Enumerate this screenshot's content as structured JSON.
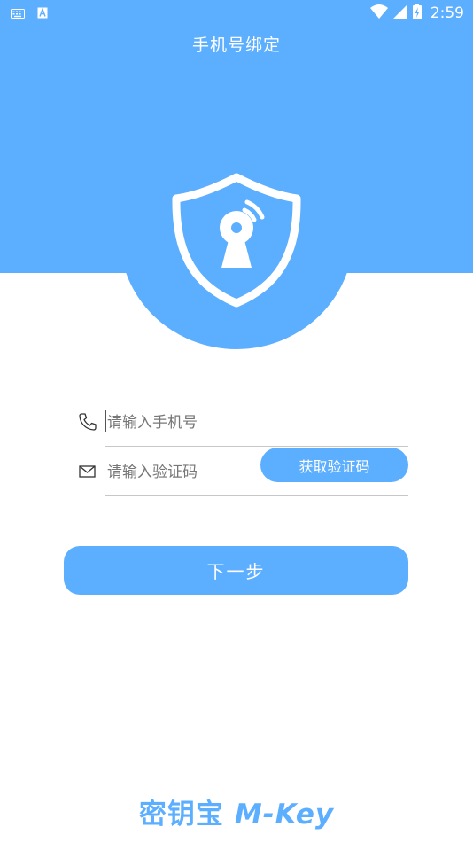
{
  "status_bar": {
    "time": "2:59",
    "icons": [
      "keyboard-icon",
      "a-notification-icon",
      "wifi-icon",
      "cell-signal-icon",
      "battery-charging-icon"
    ]
  },
  "header": {
    "title": "手机号绑定",
    "emblem_icon": "shield-key-icon",
    "background_color": "#5caeff"
  },
  "form": {
    "phone": {
      "icon": "phone-icon",
      "placeholder": "请输入手机号",
      "value": ""
    },
    "code": {
      "icon": "mail-icon",
      "placeholder": "请输入验证码",
      "value": "",
      "get_code_label": "获取验证码"
    },
    "next_label": "下一步"
  },
  "footer": {
    "brand_cn": "密钥宝",
    "brand_en": "M-Key"
  }
}
